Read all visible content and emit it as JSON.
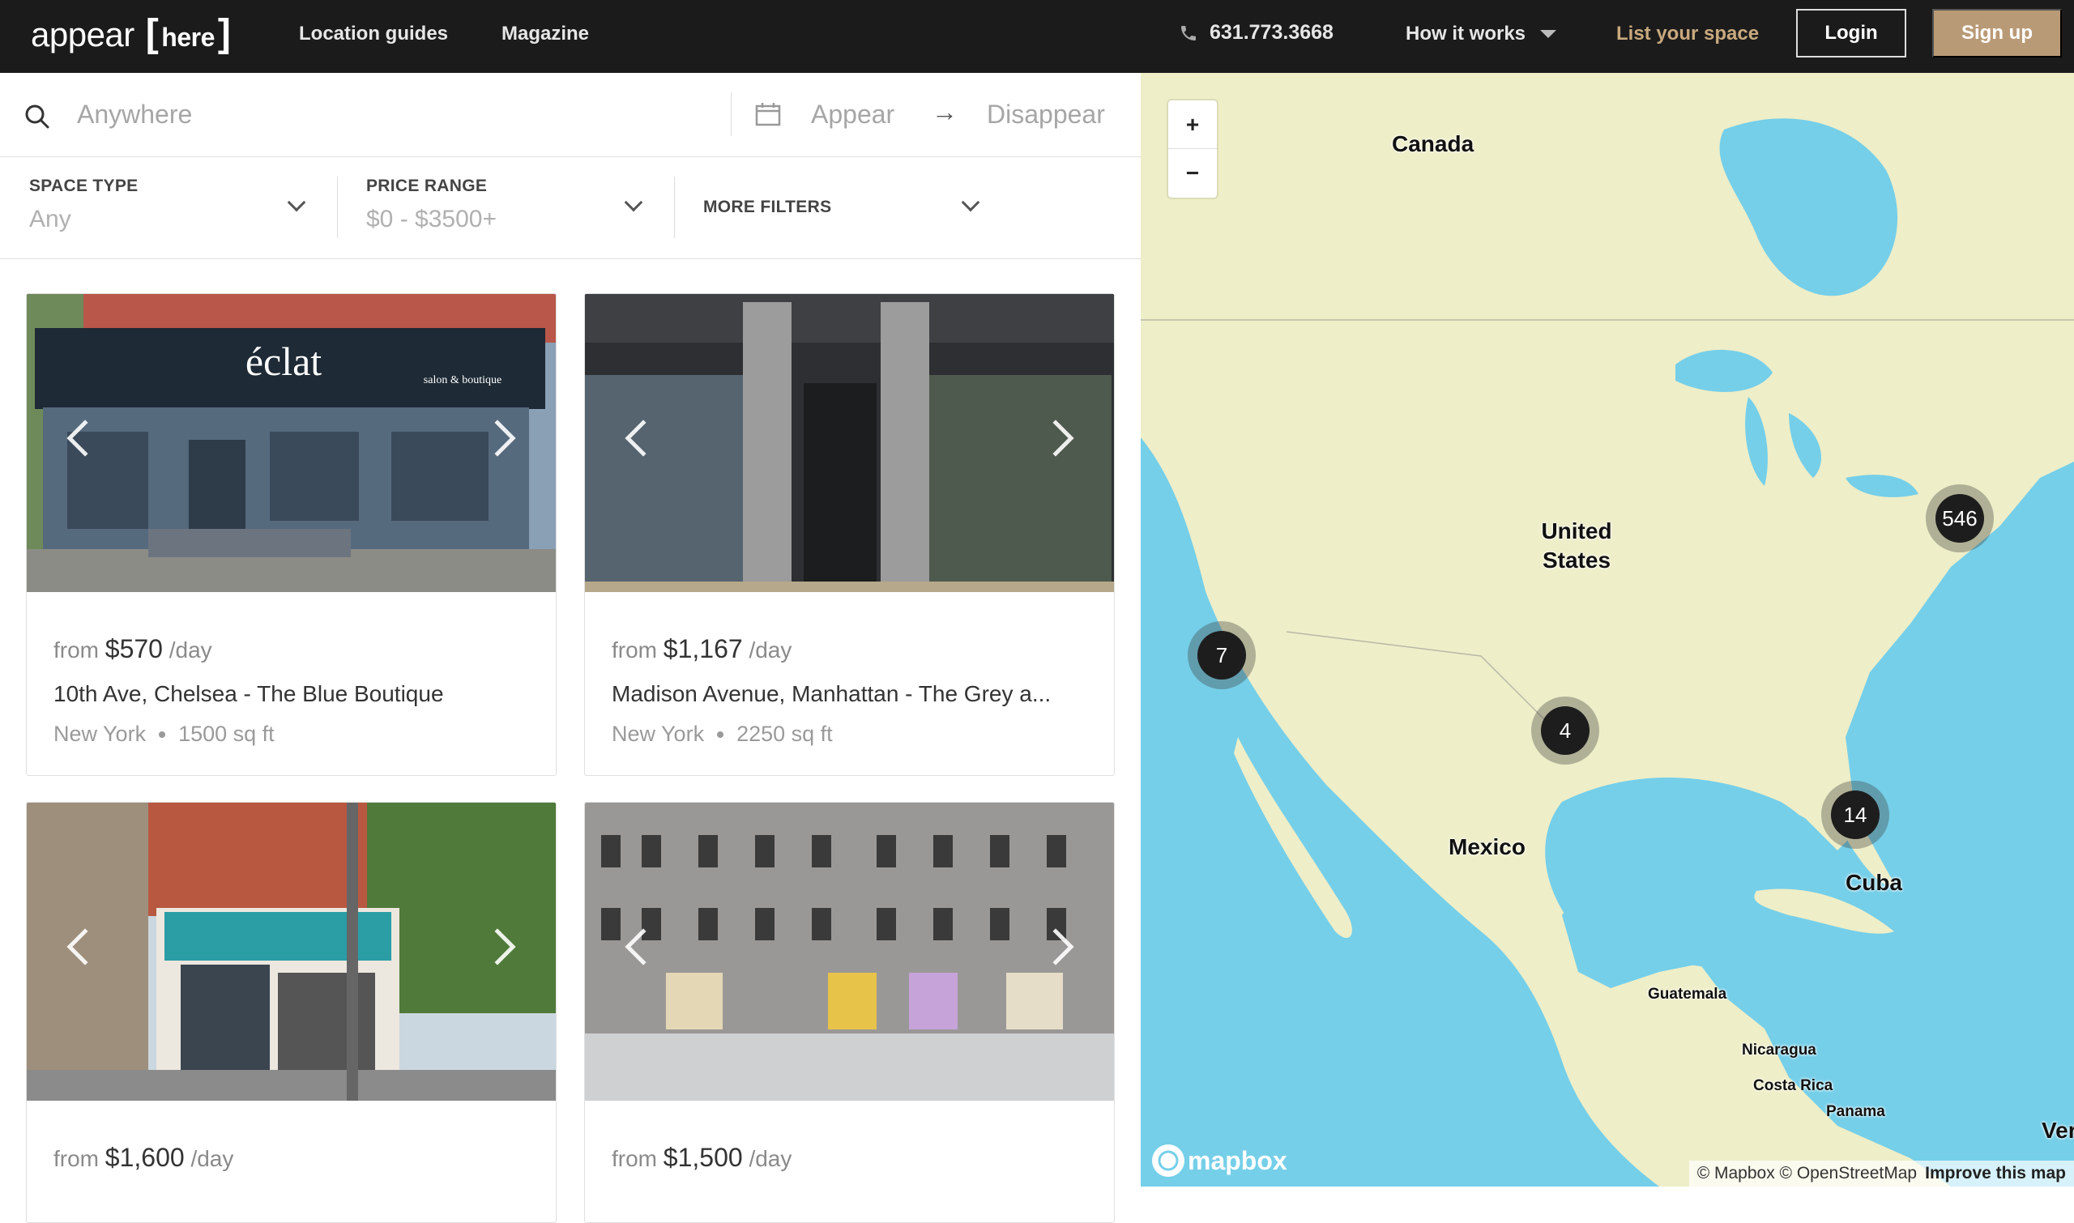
{
  "header": {
    "logo_text": "appear",
    "logo_bracket_open": "[",
    "logo_here": "here",
    "logo_bracket_close": "]",
    "nav": [
      "Location guides",
      "Magazine"
    ],
    "phone": "631.773.3668",
    "how_it_works": "How it works",
    "list_space": "List your space",
    "login": "Login",
    "signup": "Sign up",
    "accent_color": "#b99a76"
  },
  "search": {
    "placeholder": "Anywhere",
    "date_from_placeholder": "Appear",
    "arrow": "→",
    "date_to_placeholder": "Disappear"
  },
  "filters": {
    "space_type": {
      "label": "SPACE TYPE",
      "value": "Any"
    },
    "price_range": {
      "label": "PRICE RANGE",
      "value": "$0 - $3500+"
    },
    "more": {
      "label": "MORE FILTERS"
    }
  },
  "listings": [
    {
      "from": "from",
      "price": "$570",
      "per": "/day",
      "title": "10th Ave, Chelsea - The Blue Boutique",
      "city": "New York",
      "size": "1500 sq ft",
      "sign": "éclat",
      "sign_sub": "salon & boutique"
    },
    {
      "from": "from",
      "price": "$1,167",
      "per": "/day",
      "title": "Madison Avenue, Manhattan - The Grey a...",
      "city": "New York",
      "size": "2250 sq ft"
    },
    {
      "from": "from",
      "price": "$1,600",
      "per": "/day"
    },
    {
      "from": "from",
      "price": "$1,500",
      "per": "/day"
    }
  ],
  "map": {
    "zoom_in": "+",
    "zoom_out": "−",
    "labels": {
      "canada": "Canada",
      "united": "United",
      "states": "States",
      "mexico": "Mexico",
      "cuba": "Cuba",
      "guatemala": "Guatemala",
      "nicaragua": "Nicaragua",
      "costa_rica": "Costa Rica",
      "panama": "Panama",
      "venezuela": "Ver"
    },
    "clusters": [
      "546",
      "7",
      "4",
      "14"
    ],
    "mapbox": "mapbox",
    "attribution": "© Mapbox © OpenStreetMap",
    "improve": "Improve this map",
    "water_color": "#75cfe9",
    "land_color": "#eeeec8"
  }
}
